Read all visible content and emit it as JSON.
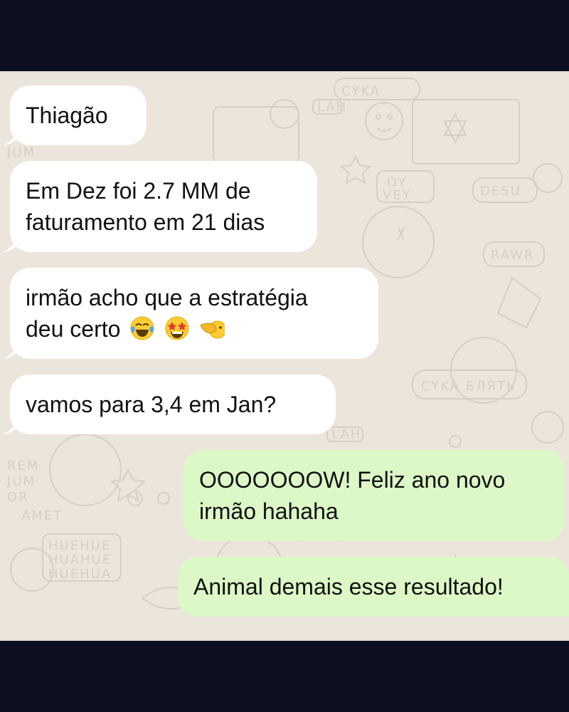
{
  "messages": [
    {
      "side": "in",
      "lines": [
        "Thiagão"
      ]
    },
    {
      "side": "in",
      "lines": [
        "Em Dez foi 2.7 MM de",
        "faturamento em 21 dias"
      ]
    },
    {
      "side": "in",
      "lines": [
        "irmão acho que a estratégia",
        "deu certo"
      ],
      "emojis": [
        "face-with-tears-of-joy-icon",
        "star-struck-icon",
        "pointing-left-hand-icon"
      ]
    },
    {
      "side": "in",
      "lines": [
        "vamos para 3,4 em Jan?"
      ]
    },
    {
      "side": "out",
      "lines": [
        "OOOOOOOW! Feliz ano novo",
        "irmão hahaha"
      ]
    },
    {
      "side": "out",
      "lines": [
        "Animal demais esse resultado!"
      ]
    }
  ],
  "colors": {
    "incoming_bubble": "#ffffff",
    "outgoing_bubble": "#dcf8c6",
    "chat_background": "#ece5dc",
    "frame": "#0b0f1f"
  }
}
